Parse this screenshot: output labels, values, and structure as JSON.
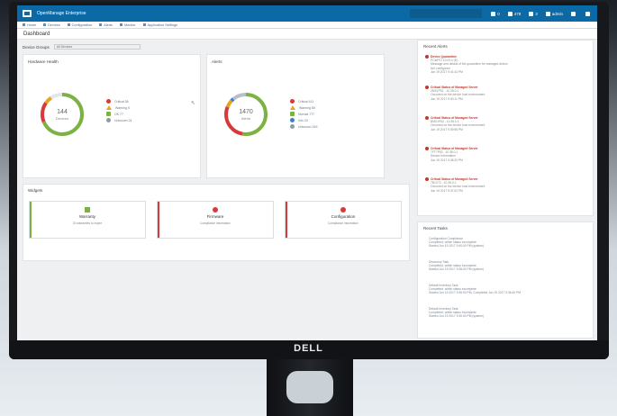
{
  "app": {
    "title": "OpenManage Enterprise",
    "nav": [
      {
        "label": "Home",
        "icon": "home-icon"
      },
      {
        "label": "Devices",
        "icon": "devices-icon"
      },
      {
        "label": "Configuration",
        "icon": "configuration-icon"
      },
      {
        "label": "Alerts",
        "icon": "alerts-icon"
      },
      {
        "label": "Monitor",
        "icon": "monitor-icon"
      },
      {
        "label": "Application Settings",
        "icon": "settings-icon"
      }
    ],
    "top_icons": [
      {
        "label": "0",
        "icon": "grid-icon"
      },
      {
        "label": "479",
        "icon": "bell-icon"
      },
      {
        "label": "3",
        "icon": "task-icon"
      },
      {
        "label": "admin",
        "icon": "user-icon"
      },
      {
        "label": "",
        "icon": "help-icon"
      },
      {
        "label": "",
        "icon": "info-icon"
      }
    ]
  },
  "dashboard": {
    "title": "Dashboard",
    "device_groups_label": "Device Groups",
    "device_groups_value": "All Devices"
  },
  "hardware_health": {
    "title": "Hardware Health",
    "center_value": "144",
    "center_label": "Devices",
    "legend": [
      {
        "label": "Critical 38",
        "color": "#d63b3b",
        "shape": "circle"
      },
      {
        "label": "Warning 5",
        "color": "#e7a327",
        "shape": "triangle"
      },
      {
        "label": "OK 77",
        "color": "#7bb241",
        "shape": "square"
      },
      {
        "label": "Unknown 24",
        "color": "#8f9aa5",
        "shape": "circle"
      }
    ]
  },
  "alerts_widget": {
    "title": "Alerts",
    "center_value": "1470",
    "center_label": "Alerts",
    "legend": [
      {
        "label": "Critical 411",
        "color": "#d63b3b",
        "shape": "circle"
      },
      {
        "label": "Warning 80",
        "color": "#e7a327",
        "shape": "triangle"
      },
      {
        "label": "Normal 777",
        "color": "#7bb241",
        "shape": "square"
      },
      {
        "label": "Info 33",
        "color": "#3b7dd8",
        "shape": "circle"
      },
      {
        "label": "Unknown 169",
        "color": "#8f9aa5",
        "shape": "circle"
      }
    ]
  },
  "widgets": {
    "title": "Widgets",
    "items": [
      {
        "label": "Warranty",
        "sub": "20 warranties to expire",
        "color": "#7bb241"
      },
      {
        "label": "Firmware",
        "sub": "Compliance Information",
        "color": "#d63b3b"
      },
      {
        "label": "Configuration",
        "sub": "Compliance Information",
        "color": "#d63b3b"
      }
    ]
  },
  "recent_alerts": {
    "title": "Recent Alerts",
    "items": [
      {
        "title": "Device Quarantine",
        "lines": [
          "PCIePCI 12:03:0 (E)",
          "Message and details of the quarantine for managed device",
          "Not configured",
          "Jun 19 2017 9:41:42 PM"
        ]
      },
      {
        "title": "Critical Status of Managed Server",
        "lines": [
          "2MX1P52 - 10.35.0.1",
          "Occurred on the device host environment",
          "Jun 19 2017 9:40:11 PM"
        ]
      },
      {
        "title": "Critical Status of Managed Server",
        "lines": [
          "BMX1P52 - 10.35.0.1",
          "Occurred on the device host environment",
          "Jun 19 2017 9:39:55 PM"
        ]
      },
      {
        "title": "Critical Status of Managed Server",
        "lines": [
          "7FT7P52 - 10.35.0.1",
          "Sensor Information",
          "Jun 19 2017 9:38:20 PM"
        ]
      },
      {
        "title": "Critical Status of Managed Server",
        "lines": [
          "7B1X72 - 10.35.0.1",
          "Occurred on the device host environment",
          "Jun 19 2017 9:37:02 PM"
        ]
      }
    ]
  },
  "recent_tasks": {
    "title": "Recent Tasks",
    "items": [
      {
        "lines": [
          "Configuration Compliance",
          "Completed, within status incomplete",
          "Started Jun 19 2017 9:40:00 PM (system)"
        ]
      },
      {
        "lines": [
          "Discovery Task",
          "Completed, within status incomplete",
          "Started Jun 19 2017 9:38:00 PM (system)"
        ]
      },
      {
        "lines": [
          "Default Inventory Task",
          "Completed, within status incomplete",
          "Started Jun 19 2017 9:36:00 PM, Completed Jun 19 2017 9:36:40 PM"
        ]
      },
      {
        "lines": [
          "Default Inventory Task",
          "Completed, within status incomplete",
          "Started Jun 19 2017 9:30:00 PM (system)"
        ]
      }
    ]
  },
  "monitor": {
    "brand": "DELL"
  }
}
